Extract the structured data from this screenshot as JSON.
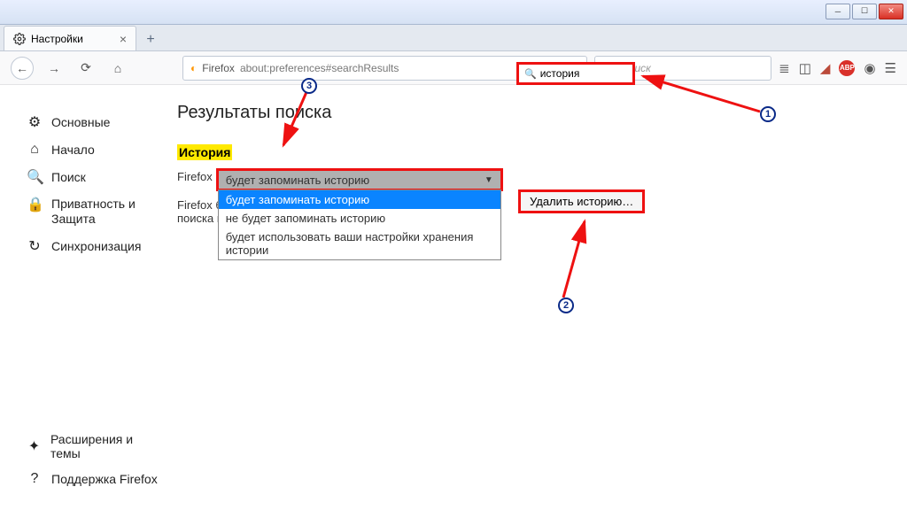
{
  "window": {
    "tab_title": "Настройки"
  },
  "urlbar": {
    "product": "Firefox",
    "address": "about:preferences#searchResults",
    "search_placeholder": "Поиск"
  },
  "sidebar": {
    "items": [
      {
        "label": "Основные"
      },
      {
        "label": "Начало"
      },
      {
        "label": "Поиск"
      },
      {
        "label": "Приватность и Защита"
      },
      {
        "label": "Синхронизация"
      }
    ],
    "bottom": [
      {
        "label": "Расширения и темы"
      },
      {
        "label": "Поддержка Firefox"
      }
    ]
  },
  "prefs": {
    "search_value": "история",
    "page_title": "Результаты поиска",
    "history_heading": "История",
    "firefox_label": "Firefox",
    "firefox_desc": "Firefox будет запоминать историю посещений, загрузок, поиска и сохранять данные форм.",
    "dropdown_selected": "будет запоминать историю",
    "dropdown_options": [
      "будет запоминать историю",
      "не будет запоминать историю",
      "будет использовать ваши настройки хранения истории"
    ],
    "clear_history_btn": "Удалить историю…"
  },
  "callouts": {
    "n1": "1",
    "n2": "2",
    "n3": "3"
  }
}
